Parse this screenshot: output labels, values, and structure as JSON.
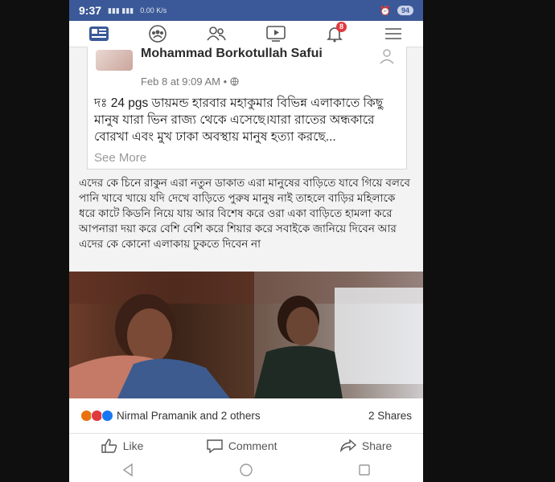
{
  "status_bar": {
    "time": "9:37",
    "signal_text": "0.00 K/s",
    "battery": "94"
  },
  "nav": {
    "notification_count": "8",
    "icons": [
      "news-feed-icon",
      "groups-icon",
      "friends-icon",
      "watch-icon",
      "notifications-icon",
      "menu-icon"
    ]
  },
  "shared_post": {
    "author": "Mohammad Borkotullah Safui",
    "time": "Feb 8 at 9:09 AM •",
    "text": "দঃ 24 pgs ডায়মন্ড হারবার মহাকুমার বিভিন্ন এলাকাতে কিছু মানুষ যারা ভিন রাজ্য থেকে এসেছে।যারা রাতের অন্ধকারে বোরখা এবং মুখ ঢাকা অবস্থায় মানুষ হত্যা করছে...",
    "see_more": "See More"
  },
  "post": {
    "text": "এদের কে চিনে রাকুন এরা নতুন ডাকাত এরা মানুষের বাড়িতে যাবে গিয়ে বলবে পানি খাবে খায়ে যদি দেখে বাড়িতে পুরুষ মানুষ নাই তাহলে বাড়ির মহিলাকে ধরে কাটে কিডনি নিয়ে যায় আর বিশেষ করে ওরা একা বাড়িতে  হামলা করে আপনারা দয়া করে বেশি বেশি করে শিয়ার করে সবাইকে জানিয়ে দিবেন আর এদের কে কোনো এলাকায় ঢুকতে দিবেন না"
  },
  "reactions": {
    "names": "Nirmal Pramanik and 2 others",
    "shares": "2 Shares"
  },
  "actions": {
    "like": "Like",
    "comment": "Comment",
    "share": "Share"
  },
  "colors": {
    "brand": "#3b5998",
    "badge": "#e0393e"
  }
}
